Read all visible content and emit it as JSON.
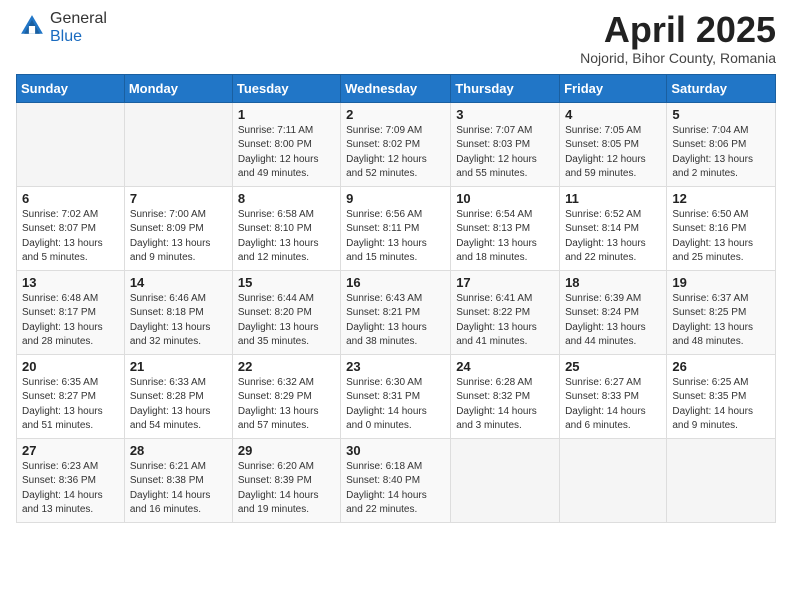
{
  "header": {
    "logo_general": "General",
    "logo_blue": "Blue",
    "title": "April 2025",
    "location": "Nojorid, Bihor County, Romania"
  },
  "days_of_week": [
    "Sunday",
    "Monday",
    "Tuesday",
    "Wednesday",
    "Thursday",
    "Friday",
    "Saturday"
  ],
  "weeks": [
    [
      {
        "day": "",
        "info": ""
      },
      {
        "day": "",
        "info": ""
      },
      {
        "day": "1",
        "info": "Sunrise: 7:11 AM\nSunset: 8:00 PM\nDaylight: 12 hours and 49 minutes."
      },
      {
        "day": "2",
        "info": "Sunrise: 7:09 AM\nSunset: 8:02 PM\nDaylight: 12 hours and 52 minutes."
      },
      {
        "day": "3",
        "info": "Sunrise: 7:07 AM\nSunset: 8:03 PM\nDaylight: 12 hours and 55 minutes."
      },
      {
        "day": "4",
        "info": "Sunrise: 7:05 AM\nSunset: 8:05 PM\nDaylight: 12 hours and 59 minutes."
      },
      {
        "day": "5",
        "info": "Sunrise: 7:04 AM\nSunset: 8:06 PM\nDaylight: 13 hours and 2 minutes."
      }
    ],
    [
      {
        "day": "6",
        "info": "Sunrise: 7:02 AM\nSunset: 8:07 PM\nDaylight: 13 hours and 5 minutes."
      },
      {
        "day": "7",
        "info": "Sunrise: 7:00 AM\nSunset: 8:09 PM\nDaylight: 13 hours and 9 minutes."
      },
      {
        "day": "8",
        "info": "Sunrise: 6:58 AM\nSunset: 8:10 PM\nDaylight: 13 hours and 12 minutes."
      },
      {
        "day": "9",
        "info": "Sunrise: 6:56 AM\nSunset: 8:11 PM\nDaylight: 13 hours and 15 minutes."
      },
      {
        "day": "10",
        "info": "Sunrise: 6:54 AM\nSunset: 8:13 PM\nDaylight: 13 hours and 18 minutes."
      },
      {
        "day": "11",
        "info": "Sunrise: 6:52 AM\nSunset: 8:14 PM\nDaylight: 13 hours and 22 minutes."
      },
      {
        "day": "12",
        "info": "Sunrise: 6:50 AM\nSunset: 8:16 PM\nDaylight: 13 hours and 25 minutes."
      }
    ],
    [
      {
        "day": "13",
        "info": "Sunrise: 6:48 AM\nSunset: 8:17 PM\nDaylight: 13 hours and 28 minutes."
      },
      {
        "day": "14",
        "info": "Sunrise: 6:46 AM\nSunset: 8:18 PM\nDaylight: 13 hours and 32 minutes."
      },
      {
        "day": "15",
        "info": "Sunrise: 6:44 AM\nSunset: 8:20 PM\nDaylight: 13 hours and 35 minutes."
      },
      {
        "day": "16",
        "info": "Sunrise: 6:43 AM\nSunset: 8:21 PM\nDaylight: 13 hours and 38 minutes."
      },
      {
        "day": "17",
        "info": "Sunrise: 6:41 AM\nSunset: 8:22 PM\nDaylight: 13 hours and 41 minutes."
      },
      {
        "day": "18",
        "info": "Sunrise: 6:39 AM\nSunset: 8:24 PM\nDaylight: 13 hours and 44 minutes."
      },
      {
        "day": "19",
        "info": "Sunrise: 6:37 AM\nSunset: 8:25 PM\nDaylight: 13 hours and 48 minutes."
      }
    ],
    [
      {
        "day": "20",
        "info": "Sunrise: 6:35 AM\nSunset: 8:27 PM\nDaylight: 13 hours and 51 minutes."
      },
      {
        "day": "21",
        "info": "Sunrise: 6:33 AM\nSunset: 8:28 PM\nDaylight: 13 hours and 54 minutes."
      },
      {
        "day": "22",
        "info": "Sunrise: 6:32 AM\nSunset: 8:29 PM\nDaylight: 13 hours and 57 minutes."
      },
      {
        "day": "23",
        "info": "Sunrise: 6:30 AM\nSunset: 8:31 PM\nDaylight: 14 hours and 0 minutes."
      },
      {
        "day": "24",
        "info": "Sunrise: 6:28 AM\nSunset: 8:32 PM\nDaylight: 14 hours and 3 minutes."
      },
      {
        "day": "25",
        "info": "Sunrise: 6:27 AM\nSunset: 8:33 PM\nDaylight: 14 hours and 6 minutes."
      },
      {
        "day": "26",
        "info": "Sunrise: 6:25 AM\nSunset: 8:35 PM\nDaylight: 14 hours and 9 minutes."
      }
    ],
    [
      {
        "day": "27",
        "info": "Sunrise: 6:23 AM\nSunset: 8:36 PM\nDaylight: 14 hours and 13 minutes."
      },
      {
        "day": "28",
        "info": "Sunrise: 6:21 AM\nSunset: 8:38 PM\nDaylight: 14 hours and 16 minutes."
      },
      {
        "day": "29",
        "info": "Sunrise: 6:20 AM\nSunset: 8:39 PM\nDaylight: 14 hours and 19 minutes."
      },
      {
        "day": "30",
        "info": "Sunrise: 6:18 AM\nSunset: 8:40 PM\nDaylight: 14 hours and 22 minutes."
      },
      {
        "day": "",
        "info": ""
      },
      {
        "day": "",
        "info": ""
      },
      {
        "day": "",
        "info": ""
      }
    ]
  ]
}
